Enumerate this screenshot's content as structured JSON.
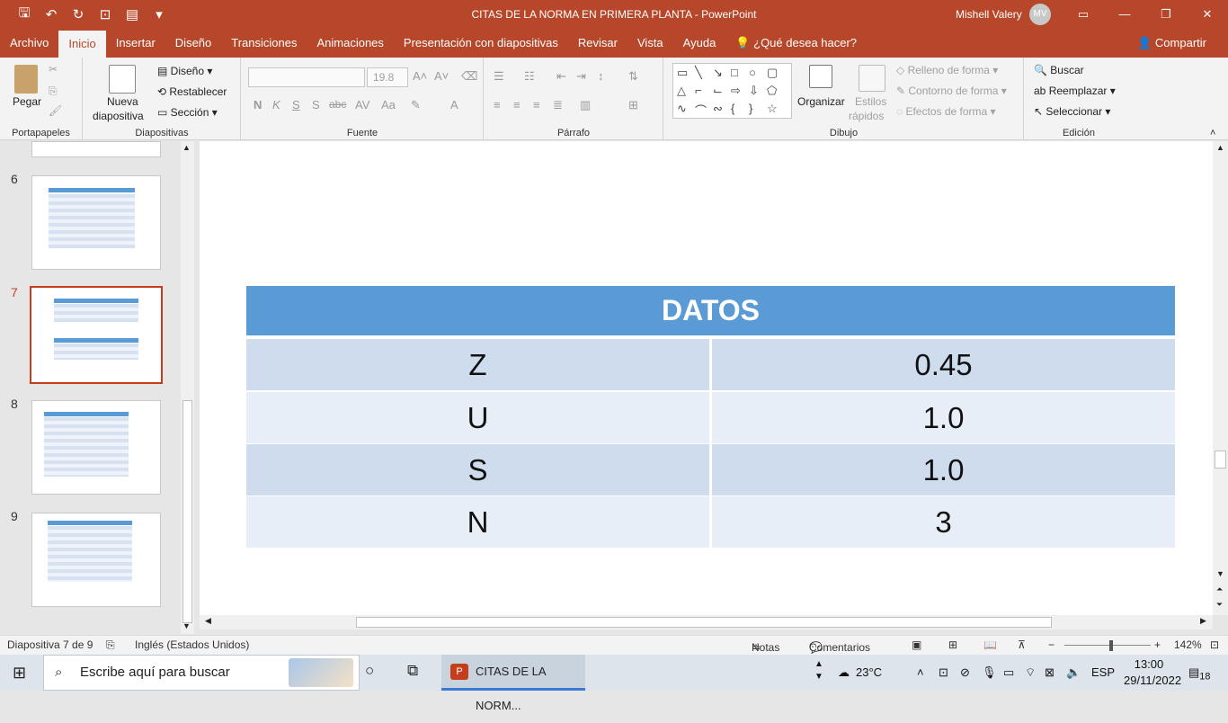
{
  "app": {
    "title": "CITAS DE LA NORMA EN PRIMERA PLANTA  -  PowerPoint",
    "user_name": "Mishell Valery",
    "user_initials": "MV",
    "share_label": "Compartir"
  },
  "menu": {
    "tabs": [
      "Archivo",
      "Inicio",
      "Insertar",
      "Diseño",
      "Transiciones",
      "Animaciones",
      "Presentación con diapositivas",
      "Revisar",
      "Vista",
      "Ayuda"
    ],
    "tell_me": "¿Qué desea hacer?"
  },
  "ribbon": {
    "portapapeles": {
      "label": "Portapapeles",
      "paste": "Pegar"
    },
    "diapositivas": {
      "label": "Diapositivas",
      "new_slide_1": "Nueva",
      "new_slide_2": "diapositiva",
      "layout": "Diseño",
      "reset": "Restablecer",
      "section": "Sección"
    },
    "fuente": {
      "label": "Fuente",
      "size": "19.8",
      "bold": "N",
      "italic": "K",
      "underline": "S",
      "shadow": "S",
      "strike": "abc"
    },
    "parrafo": {
      "label": "Párrafo"
    },
    "dibujo": {
      "label": "Dibujo",
      "arrange": "Organizar",
      "styles_1": "Estilos",
      "styles_2": "rápidos",
      "fill": "Relleno de forma",
      "outline": "Contorno de forma",
      "effects": "Efectos de forma"
    },
    "edicion": {
      "label": "Edición",
      "find": "Buscar",
      "replace": "Reemplazar",
      "select": "Seleccionar"
    }
  },
  "slides_panel": {
    "numbers": [
      "6",
      "7",
      "8",
      "9"
    ],
    "selected": "7"
  },
  "slide": {
    "header": "DATOS",
    "rows": [
      {
        "label": "Z",
        "value": "0.45"
      },
      {
        "label": "U",
        "value": "1.0"
      },
      {
        "label": "S",
        "value": "1.0"
      },
      {
        "label": "N",
        "value": "3"
      }
    ],
    "row_colors": [
      "#cfdcee",
      "#e8eef7"
    ]
  },
  "status": {
    "slide_info": "Diapositiva 7 de 9",
    "language": "Inglés (Estados Unidos)",
    "notes": "Notas",
    "comments": "Comentarios",
    "zoom": "142%"
  },
  "taskbar": {
    "search_placeholder": "Escribe aquí para buscar",
    "app_label": "CITAS DE LA NORM...",
    "temperature": "23°C",
    "lang": "ESP",
    "time": "13:00",
    "date": "29/11/2022",
    "notifications": "18"
  },
  "colors": {
    "accent": "#b7472a",
    "header_blue": "#5b9bd5",
    "selected_border": "#c43e1c"
  }
}
